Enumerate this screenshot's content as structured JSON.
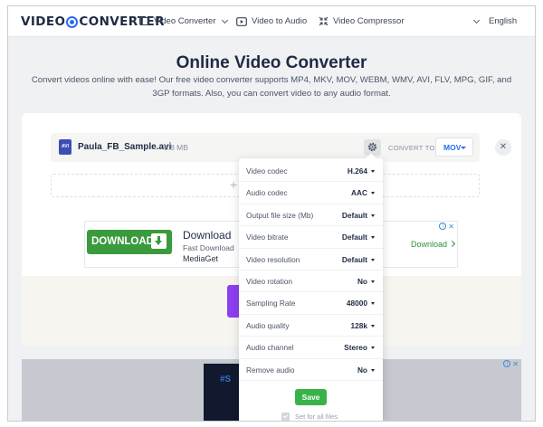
{
  "header": {
    "logo_left": "VIDEO",
    "logo_right": "CONVERTER",
    "nav": [
      {
        "label": "Video Converter",
        "icon": "video-camera-icon"
      },
      {
        "label": "Video to Audio",
        "icon": "play-icon"
      },
      {
        "label": "Video Compressor",
        "icon": "compress-icon"
      }
    ],
    "language": "English",
    "accent_color": "#2a6cf0"
  },
  "hero": {
    "title": "Online Video Converter",
    "subtitle": "Convert videos online with ease! Our free video converter supports MP4, MKV, MOV, WEBM, WMV, AVI, FLV, MPG, GIF, and 3GP formats. Also, you can convert video to any audio format."
  },
  "file": {
    "type_badge": "AVI",
    "name": "Paula_FB_Sample.avi",
    "size": "5.8 MB",
    "convert_to_label": "CONVERT TO",
    "format": "MOV"
  },
  "ad": {
    "button_label": "DOWNLOAD",
    "title": "Download",
    "subtitle": "Fast Download",
    "brand": "MediaGet",
    "link_label": "Download"
  },
  "settings": {
    "options": [
      {
        "label": "Video codec",
        "value": "H.264"
      },
      {
        "label": "Audio codec",
        "value": "AAC"
      },
      {
        "label": "Output file size (Mb)",
        "value": "Default"
      },
      {
        "label": "Video bitrate",
        "value": "Default"
      },
      {
        "label": "Video resolution",
        "value": "Default"
      },
      {
        "label": "Video rotation",
        "value": "No"
      },
      {
        "label": "Sampling Rate",
        "value": "48000"
      },
      {
        "label": "Audio quality",
        "value": "128k"
      },
      {
        "label": "Audio channel",
        "value": "Stereo"
      },
      {
        "label": "Remove audio",
        "value": "No"
      }
    ],
    "save_label": "Save",
    "set_all_label": "Set for all files",
    "save_color": "#3ab24a"
  },
  "bottom_ad": {
    "text": "#S"
  }
}
